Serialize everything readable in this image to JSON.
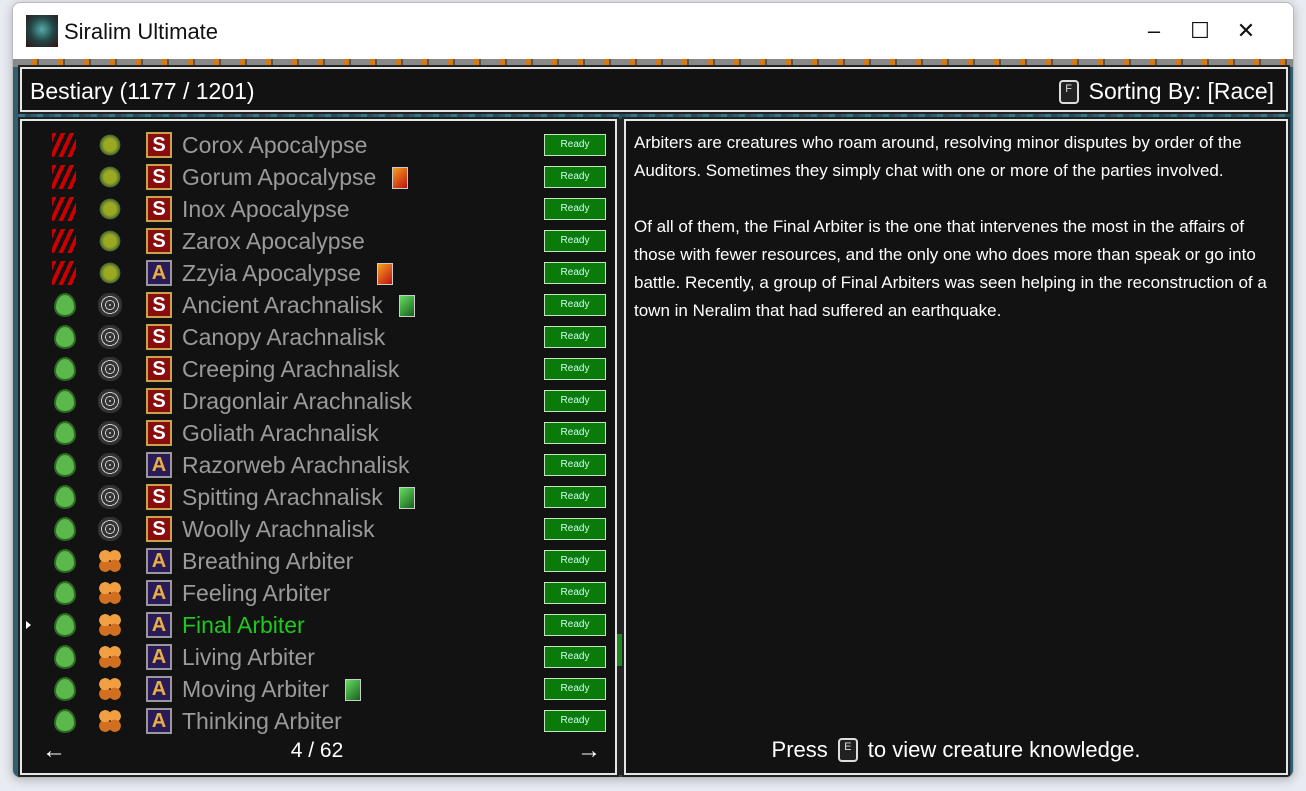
{
  "window": {
    "title": "Siralim Ultimate",
    "minimize": "–",
    "maximize": "☐",
    "close": "✕"
  },
  "header": {
    "title": "Bestiary (1177 / 1201)",
    "sort_key": "F",
    "sort_label": "Sorting By: [Race]"
  },
  "list": {
    "ready_label": "Ready",
    "rows": [
      {
        "name": "Corox Apocalypse",
        "element": "chaos",
        "race": "serpent",
        "class": "S",
        "extra": ""
      },
      {
        "name": "Gorum Apocalypse",
        "element": "chaos",
        "race": "serpent",
        "class": "S",
        "extra": "red"
      },
      {
        "name": "Inox Apocalypse",
        "element": "chaos",
        "race": "serpent",
        "class": "S",
        "extra": ""
      },
      {
        "name": "Zarox Apocalypse",
        "element": "chaos",
        "race": "serpent",
        "class": "S",
        "extra": ""
      },
      {
        "name": "Zzyia Apocalypse",
        "element": "chaos",
        "race": "serpent",
        "class": "A",
        "extra": "red"
      },
      {
        "name": "Ancient Arachnalisk",
        "element": "nature",
        "race": "web",
        "class": "S",
        "extra": "green"
      },
      {
        "name": "Canopy Arachnalisk",
        "element": "nature",
        "race": "web",
        "class": "S",
        "extra": ""
      },
      {
        "name": "Creeping Arachnalisk",
        "element": "nature",
        "race": "web",
        "class": "S",
        "extra": ""
      },
      {
        "name": "Dragonlair Arachnalisk",
        "element": "nature",
        "race": "web",
        "class": "S",
        "extra": ""
      },
      {
        "name": "Goliath Arachnalisk",
        "element": "nature",
        "race": "web",
        "class": "S",
        "extra": ""
      },
      {
        "name": "Razorweb Arachnalisk",
        "element": "nature",
        "race": "web",
        "class": "A",
        "extra": ""
      },
      {
        "name": "Spitting Arachnalisk",
        "element": "nature",
        "race": "web",
        "class": "S",
        "extra": "green"
      },
      {
        "name": "Woolly Arachnalisk",
        "element": "nature",
        "race": "web",
        "class": "S",
        "extra": ""
      },
      {
        "name": "Breathing Arbiter",
        "element": "nature",
        "race": "arbiter",
        "class": "A",
        "extra": ""
      },
      {
        "name": "Feeling Arbiter",
        "element": "nature",
        "race": "arbiter",
        "class": "A",
        "extra": ""
      },
      {
        "name": "Final Arbiter",
        "element": "nature",
        "race": "arbiter",
        "class": "A",
        "extra": "",
        "selected": true
      },
      {
        "name": "Living Arbiter",
        "element": "nature",
        "race": "arbiter",
        "class": "A",
        "extra": ""
      },
      {
        "name": "Moving Arbiter",
        "element": "nature",
        "race": "arbiter",
        "class": "A",
        "extra": "green"
      },
      {
        "name": "Thinking Arbiter",
        "element": "nature",
        "race": "arbiter",
        "class": "A",
        "extra": ""
      }
    ],
    "page": "4 / 62",
    "prev": "←",
    "next": "→"
  },
  "detail": {
    "p1": "Arbiters are creatures who roam around, resolving minor disputes by order of the Auditors. Sometimes they simply chat with one or more of the parties involved.",
    "p2": "Of all of them, the Final Arbiter is the one that intervenes the most in the affairs of those with fewer resources, and the only one who does more than speak or go into battle. Recently, a group of Final Arbiters was seen helping in the reconstruction of a town in Neralim that had suffered an earthquake.",
    "press": "Press",
    "key": "E",
    "press_suffix": "to view creature knowledge."
  }
}
